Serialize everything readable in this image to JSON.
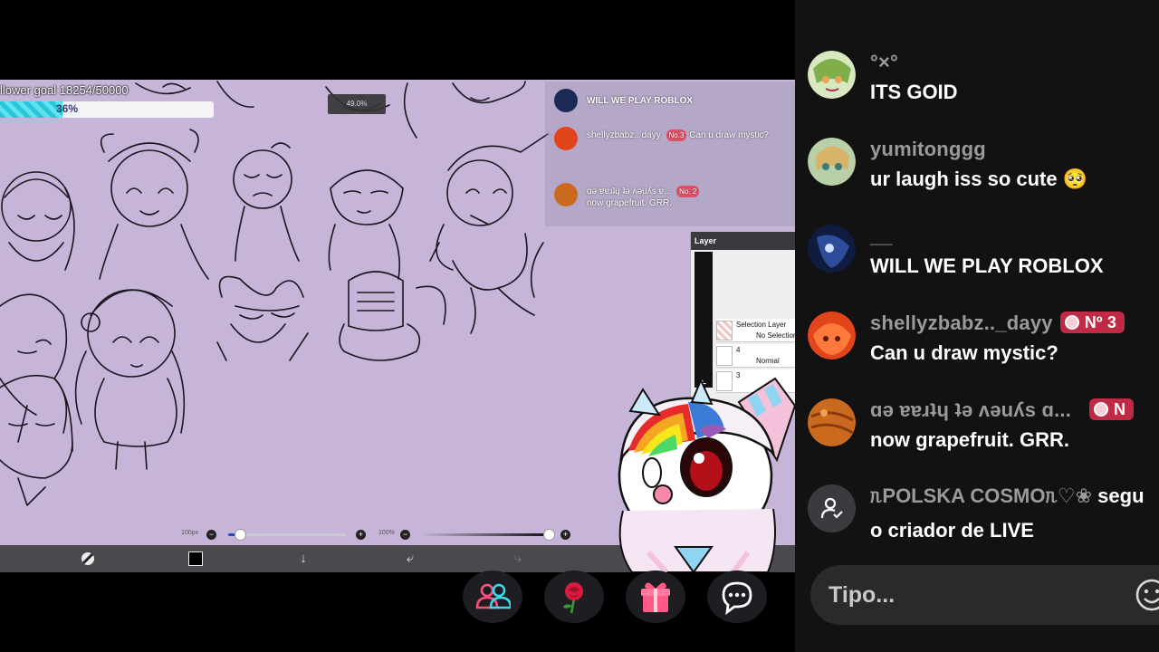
{
  "stream": {
    "follower_goal": {
      "label": "llower goal 18254/50000",
      "percent_text": "36%",
      "progress": 0.365
    },
    "opacity_chip": "49.0%",
    "mini_chat": [
      {
        "text": "WILL WE PLAY ROBLOX"
      },
      {
        "text": "shellyzbabz.. dayy",
        "badge": "No.3",
        "extra": "Can u draw mystic?"
      },
      {
        "text": "ɑə ɐɐɹʇɥ ʇǝ ʌǝuʎs ɐ...",
        "badge": "No. 2",
        "extra": "now grapefruit. GRR."
      }
    ],
    "layer_panel": {
      "title": "Layer",
      "rows": [
        {
          "label": "Selection Layer",
          "sub": "No Selection"
        },
        {
          "label": "4",
          "sub": "Normal"
        },
        {
          "label": "3",
          "sub": ""
        }
      ],
      "blend_label": "rmal"
    },
    "sliders": {
      "size_label": "100px",
      "size_value": 0.1,
      "opacity_label": "100%",
      "opacity_value": 1.0
    },
    "toolbar": {
      "down_icon": "↓",
      "undo_icon": "⤶",
      "redo_icon": "⤷"
    }
  },
  "chat": {
    "messages": [
      {
        "user": "°×°",
        "text": "ITS GOID",
        "avatar_color": "#a9c47a"
      },
      {
        "user": "yumitonggg",
        "text": "ur laugh iss so cute 🥺",
        "avatar_color": "#8fb08a"
      },
      {
        "user": "__",
        "text": "WILL WE PLAY ROBLOX",
        "avatar_color": "#1b2a55"
      },
      {
        "user": "shellyzbabz.._dayy",
        "text": "Can u draw mystic?",
        "avatar_color": "#e2451c",
        "badge": "Nº 3"
      },
      {
        "user": "ɑə ɐɐɹʇɥ ʇǝ ʌǝuʎs ɑ...",
        "text": "now grapefruit. GRR.",
        "avatar_color": "#c96a1e",
        "badge": "N"
      }
    ],
    "system": {
      "user": "ᥰPOLSKA COSMOᥰ♡❀",
      "action": "segu",
      "line2": "o criador de LIVE"
    },
    "input_placeholder": "Tipo..."
  },
  "colors": {
    "canvas_bg": "#c6b5d8",
    "chat_bg": "#121212",
    "badge_red": "#bf2a44",
    "goal_fill": "#27c6d8"
  }
}
